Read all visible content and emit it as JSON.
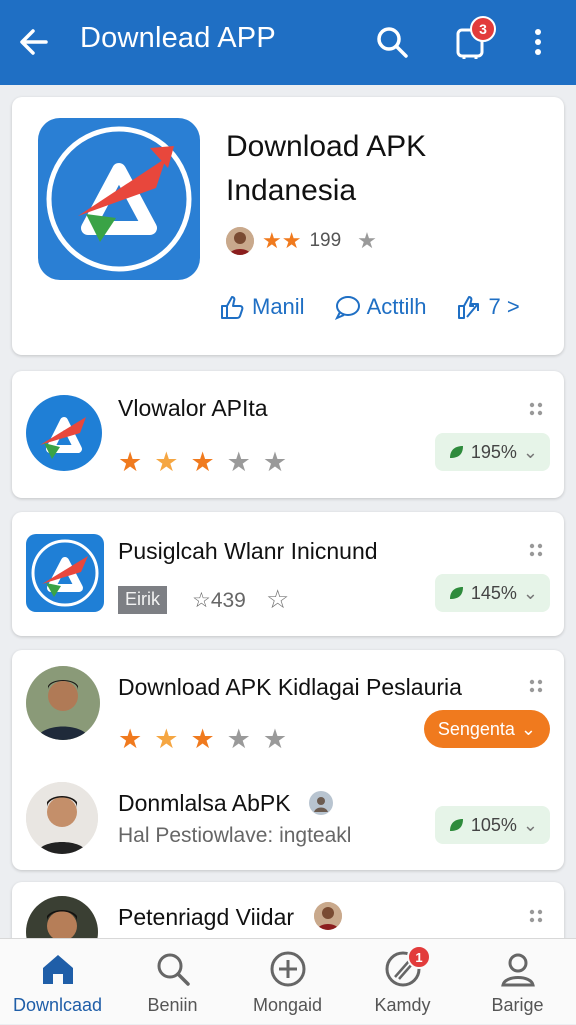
{
  "header": {
    "title": "Downlead APP",
    "cart_badge": "3"
  },
  "hero": {
    "title": "Download APK Indanesia",
    "rating_count": "199",
    "actions": [
      {
        "label": "Manil",
        "icon": "thumbs-up-icon"
      },
      {
        "label": "Acttilh",
        "icon": "comment-icon"
      },
      {
        "label": "7 >",
        "icon": "share-icon"
      }
    ]
  },
  "rows": [
    {
      "name": "Vlowalor APIta",
      "rating": 3,
      "pill": "195%"
    },
    {
      "name": "Pusiglcah Wlanr Inicnund",
      "tag": "Eirik",
      "count": "☆439",
      "pill": "145%"
    },
    {
      "name": "Download APK Kidlagai Peslauria",
      "rating": 3,
      "pill": "Sengenta"
    },
    {
      "name": "Donmlalsa AbPK",
      "sub": "Hal Pestiowlave: ingteakl",
      "pill": "105%"
    },
    {
      "name": "Petenriagd Viidar"
    }
  ],
  "nav": [
    {
      "label": "Downlcaad",
      "icon": "home-icon"
    },
    {
      "label": "Beniin",
      "icon": "search-icon"
    },
    {
      "label": "Mongaid",
      "icon": "add-circle-icon"
    },
    {
      "label": "Kamdy",
      "icon": "compass-icon",
      "badge": "1"
    },
    {
      "label": "Barige",
      "icon": "profile-icon"
    }
  ],
  "colors": {
    "primary": "#1f6fc4",
    "star": "#f07a1e",
    "badge": "#e23b3b",
    "pill_green": "#e6f4e8",
    "leaf": "#2e8b3c"
  }
}
